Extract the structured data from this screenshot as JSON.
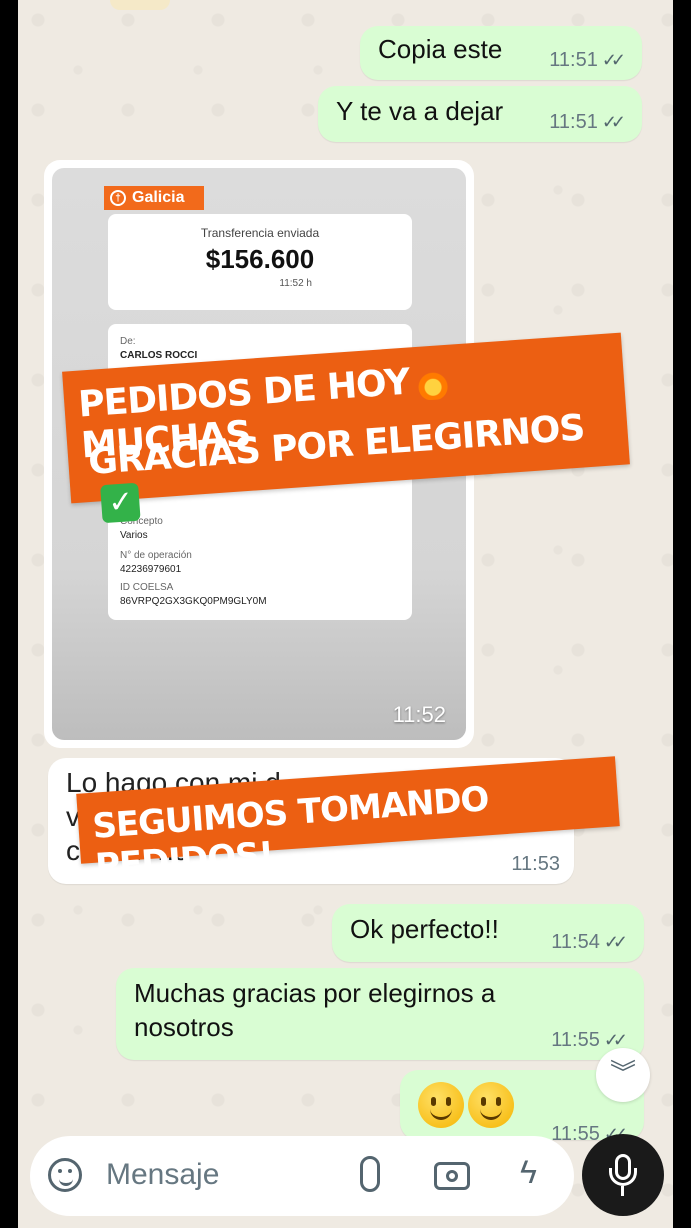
{
  "messages": [
    {
      "text": "Copia este",
      "time": "11:51"
    },
    {
      "text": "Y te va a dejar",
      "time": "11:51"
    },
    {
      "image_time": "11:52"
    },
    {
      "text": "Lo hago con mi d...\nv...\nc... p... no",
      "time": "11:53"
    },
    {
      "text": "Ok perfecto!!",
      "time": "11:54"
    },
    {
      "text": "Muchas gracias por elegirnos a\nnosotros",
      "time": "11:55"
    },
    {
      "time": "11:55"
    }
  ],
  "receipt": {
    "bank": "Galicia",
    "title": "Transferencia enviada",
    "amount": "$156.600",
    "time": "11:52 h",
    "from_label": "De:",
    "from_name": "CARLOS ROCCI",
    "concept_label": "Concepto",
    "concept_value": "Varios",
    "op_label": "N° de operación",
    "op_value": "42236979601",
    "coelsa_label": "ID COELSA",
    "coelsa_value": "86VRPQ2GX3GKQ0PM9GLY0M"
  },
  "stickers": {
    "line1": "PEDIDOS DE HOY",
    "line1b": "MUCHAS",
    "line2": "GRACIAS POR ELEGIRNOS",
    "second": "SEGUIMOS TOMANDO PEDIDOS!"
  },
  "composer": {
    "placeholder": "Mensaje"
  },
  "colors": {
    "outgoing": "#d9fdd3",
    "incoming": "#ffffff",
    "sticker": "#ec5f12",
    "background": "#efeae2"
  }
}
